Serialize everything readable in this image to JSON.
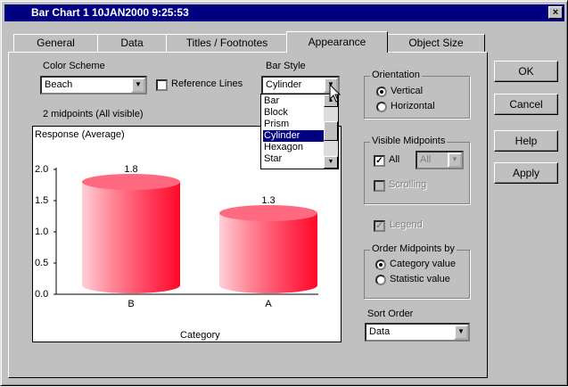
{
  "window": {
    "title": "Bar Chart 1 10JAN2000  9:25:53",
    "close_glyph": "×"
  },
  "tabs": [
    {
      "label": "General"
    },
    {
      "label": "Data"
    },
    {
      "label": "Titles / Footnotes"
    },
    {
      "label": "Appearance"
    },
    {
      "label": "Object Size"
    }
  ],
  "buttons": {
    "ok": "OK",
    "cancel": "Cancel",
    "help": "Help",
    "apply": "Apply"
  },
  "color_scheme": {
    "label": "Color Scheme",
    "value": "Beach"
  },
  "reference_lines": {
    "label": "Reference Lines",
    "checked": false
  },
  "bar_style": {
    "label": "Bar Style",
    "value": "Cylinder",
    "options": [
      "Bar",
      "Block",
      "Prism",
      "Cylinder",
      "Hexagon",
      "Star"
    ],
    "selected": "Cylinder"
  },
  "orientation": {
    "title": "Orientation",
    "vertical": "Vertical",
    "horizontal": "Horizontal",
    "selected": "Vertical"
  },
  "visible_midpoints": {
    "title": "Visible Midpoints",
    "all_label": "All",
    "all_checked": true,
    "combo_value": "All",
    "scrolling_label": "Scrolling",
    "scrolling_checked": false
  },
  "legend": {
    "label": "Legend",
    "checked": true
  },
  "order_midpoints": {
    "title": "Order Midpoints by",
    "category": "Category value",
    "statistic": "Statistic value",
    "selected": "Category value"
  },
  "sort_order": {
    "label": "Sort Order",
    "value": "Data"
  },
  "midpoints_info": "2 midpoints (All visible)",
  "chart_data": {
    "type": "bar",
    "bar_style": "cylinder",
    "title": "Response (Average)",
    "xlabel": "Category",
    "categories": [
      "B",
      "A"
    ],
    "values": [
      1.8,
      1.3
    ],
    "data_labels": [
      "1.8",
      "1.3"
    ],
    "yticks": [
      "2.0",
      "1.5",
      "1.0",
      "0.5",
      "0.0"
    ],
    "ylim": [
      0,
      2.0
    ],
    "bar_color": "#ff4060"
  }
}
